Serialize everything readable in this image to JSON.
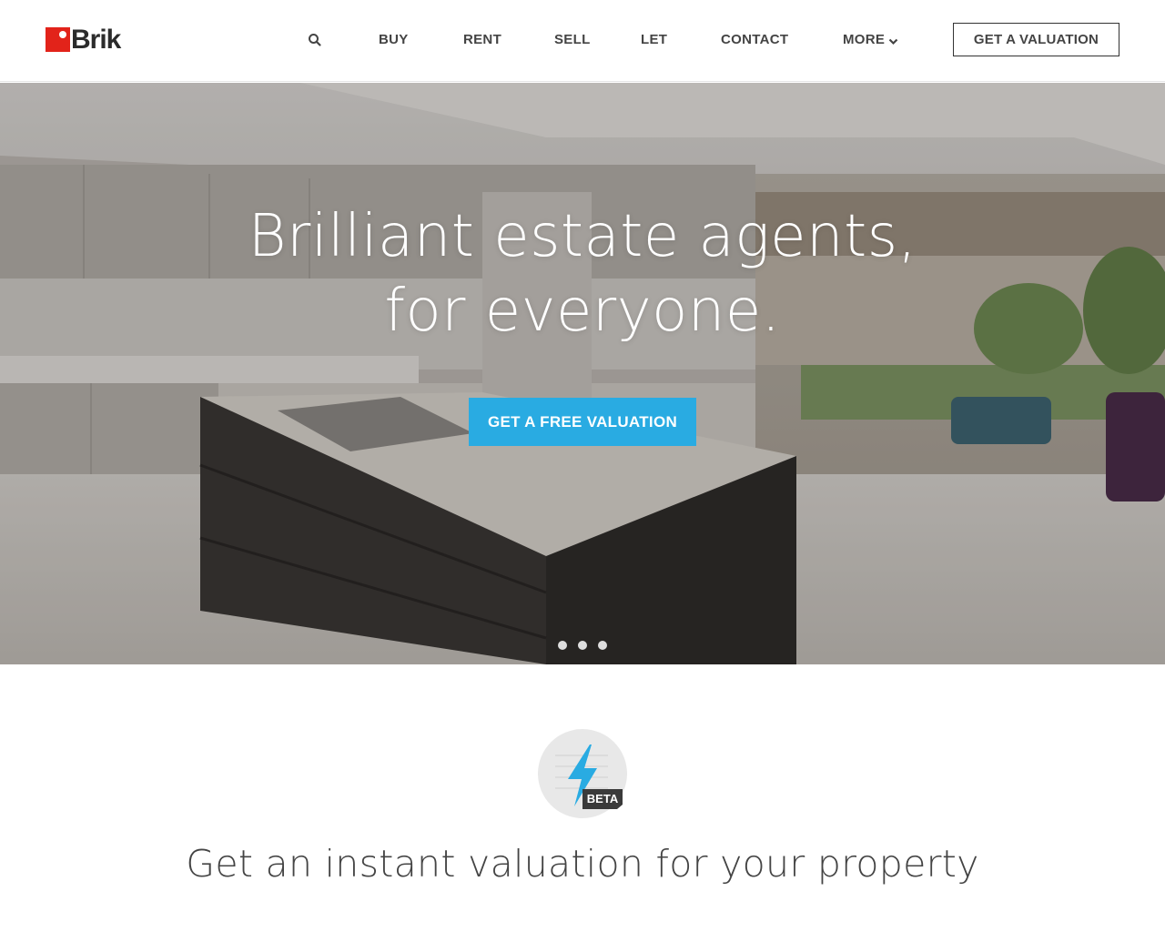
{
  "brand": {
    "name": "Brik",
    "color": "#e2231a"
  },
  "nav": {
    "search_icon": "search-icon",
    "items": [
      {
        "label": "BUY"
      },
      {
        "label": "RENT"
      },
      {
        "label": "SELL"
      },
      {
        "label": "LET"
      },
      {
        "label": "CONTACT"
      },
      {
        "label": "MORE"
      }
    ],
    "cta_label": "GET A VALUATION"
  },
  "hero": {
    "title_line1": "Brilliant estate agents,",
    "title_line2": "for everyone.",
    "cta_label": "GET A FREE VALUATION",
    "cta_color": "#29abe2",
    "slides": 3,
    "active_slide": 1
  },
  "instant": {
    "badge_label": "BETA",
    "title": "Get an instant valuation for your property"
  }
}
